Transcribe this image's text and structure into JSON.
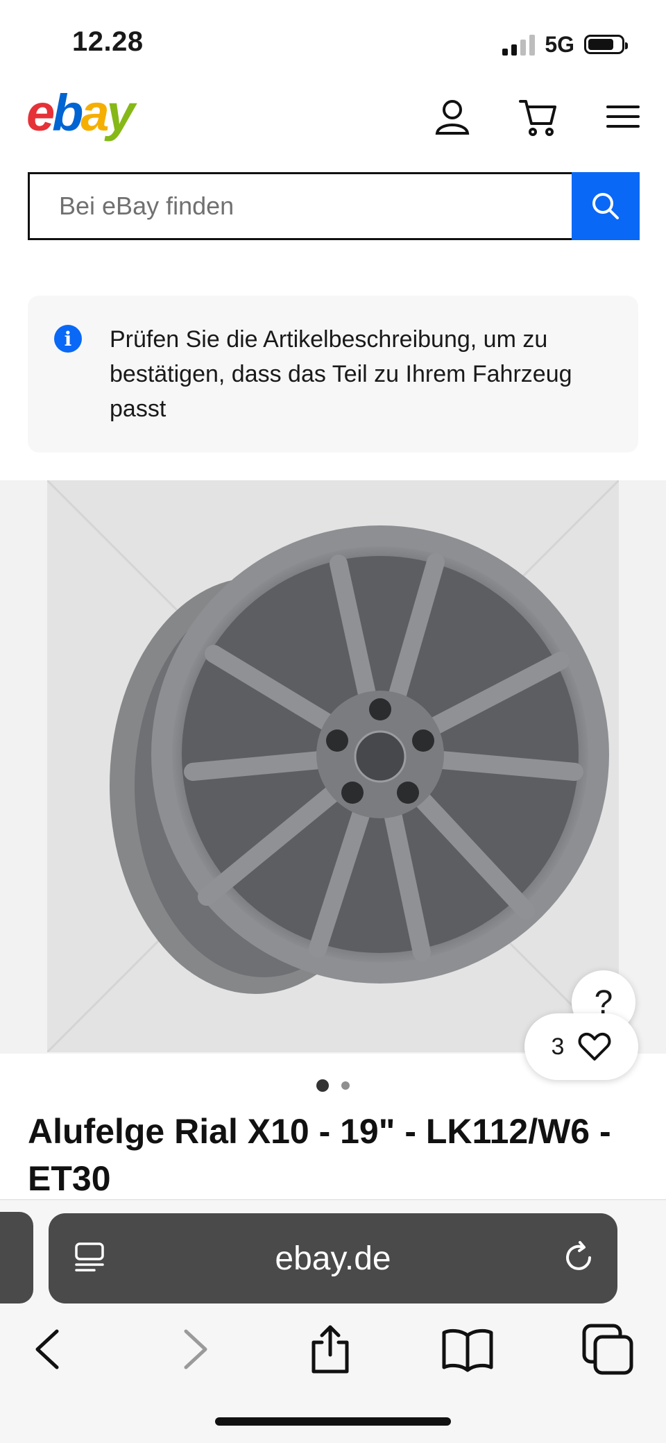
{
  "status_bar": {
    "time": "12.28",
    "network": "5G",
    "signal_bars": 2,
    "battery_level": 0.78
  },
  "header": {
    "logo": {
      "e": "e",
      "b": "b",
      "a": "a",
      "y": "y"
    },
    "icons": [
      "account-icon",
      "cart-icon",
      "menu-icon"
    ]
  },
  "search": {
    "placeholder": "Bei eBay finden"
  },
  "notice": {
    "text": "Prüfen Sie die Artikelbeschreibung, um zu bestätigen, dass das Teil zu Ihrem Fahrzeug passt",
    "icon": "i"
  },
  "gallery": {
    "help_label": "?",
    "watch_count": "3",
    "pages": 2,
    "current_page": 1
  },
  "listing": {
    "title": "Alufelge Rial X10 - 19\" - LK112/W6 - ET30"
  },
  "browser": {
    "url": "ebay.de"
  },
  "colors": {
    "accent": "#0968f6",
    "ebay_red": "#e53238",
    "ebay_blue": "#0064d2",
    "ebay_yellow": "#f5af02",
    "ebay_green": "#86b817"
  }
}
